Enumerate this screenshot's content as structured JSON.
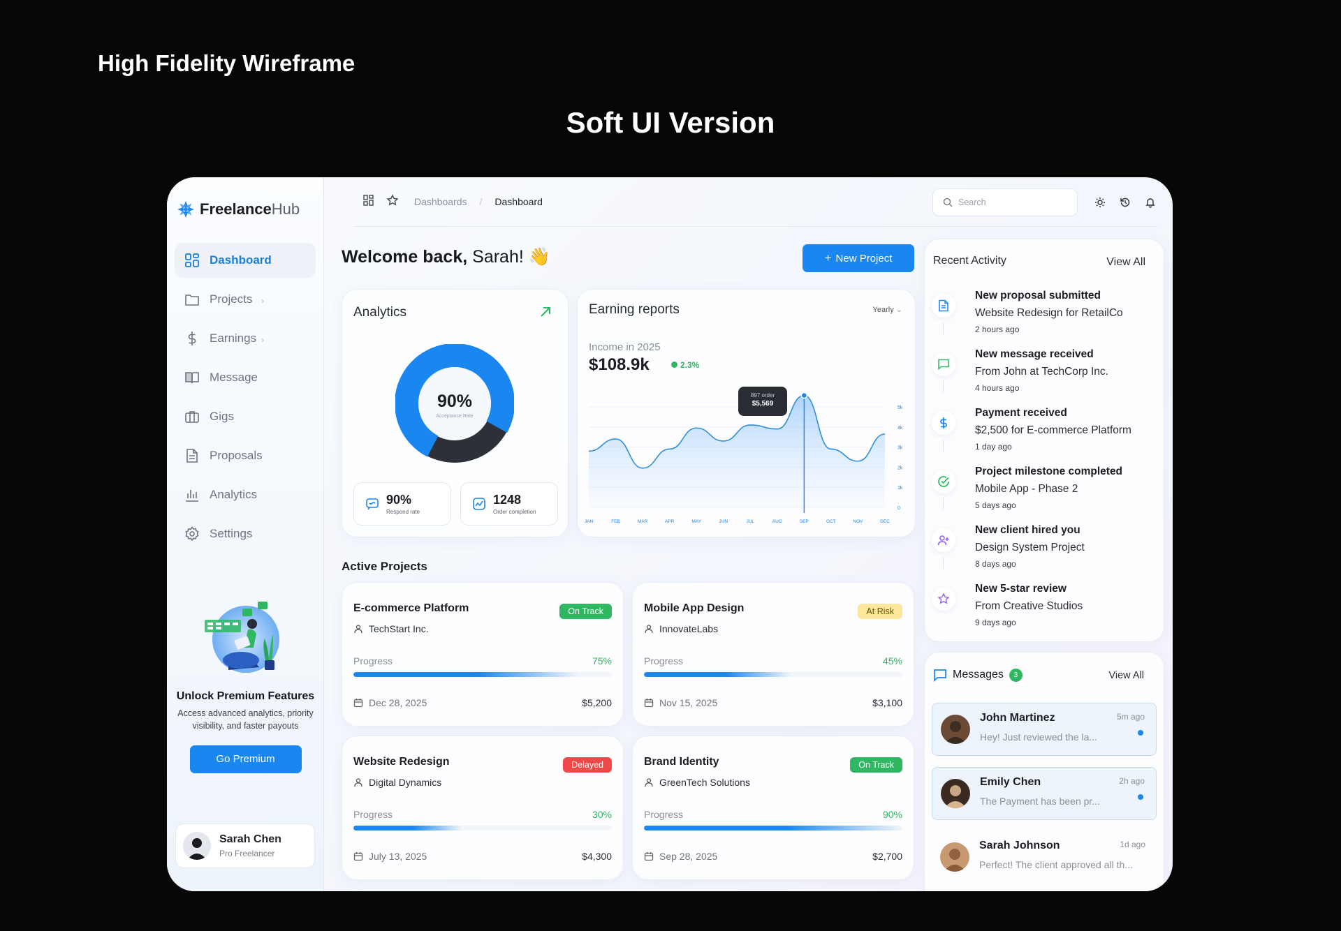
{
  "page": {
    "title": "High Fidelity Wireframe",
    "subtitle": "Soft UI Version"
  },
  "colors": {
    "accent": "#1a86f0",
    "success": "#2fb761",
    "warning": "#fde79a",
    "danger": "#f04848"
  },
  "brand": {
    "name_bold": "Freelance",
    "name_light": "Hub"
  },
  "nav": [
    {
      "label": "Dashboard",
      "icon": "grid-icon",
      "active": true
    },
    {
      "label": "Projects",
      "icon": "folder-icon"
    },
    {
      "label": "Earnings",
      "icon": "dollar-icon"
    },
    {
      "label": "Message",
      "icon": "book-icon"
    },
    {
      "label": "Gigs",
      "icon": "briefcase-icon"
    },
    {
      "label": "Proposals",
      "icon": "document-icon"
    },
    {
      "label": "Analytics",
      "icon": "bar-chart-icon"
    },
    {
      "label": "Settings",
      "icon": "gear-icon"
    }
  ],
  "promo": {
    "title": "Unlock Premium Features",
    "desc": "Access advanced analytics, priority visibility, and faster payouts",
    "button": "Go Premium"
  },
  "user": {
    "name": "Sarah Chen",
    "role": "Pro Freelancer"
  },
  "topbar": {
    "crumb_parent": "Dashboards",
    "crumb_current": "Dashboard",
    "search_placeholder": "Search"
  },
  "welcome": {
    "bold": "Welcome back,",
    "name": "Sarah! 👋",
    "new_button": "New Project"
  },
  "analytics": {
    "title": "Analytics",
    "acceptance_value": "90%",
    "acceptance_label": "Acceptance Rate",
    "acceptance_fraction": 0.9,
    "respond_value": "90%",
    "respond_label": "Respond rate",
    "order_value": "1248",
    "order_label": "Order completion"
  },
  "earnings": {
    "title": "Earning reports",
    "period": "Yearly",
    "income_label": "Income in 2025",
    "income_value": "$108.9k",
    "change": "2.3%",
    "tooltip_orders": "897 order",
    "tooltip_value": "$5,569"
  },
  "chart_data": {
    "type": "area",
    "title": "Earning reports",
    "categories": [
      "JAN",
      "FEB",
      "MAR",
      "APR",
      "MAY",
      "JUN",
      "JUL",
      "AUG",
      "SEP",
      "OCT",
      "NOV",
      "DEC"
    ],
    "y_ticks": [
      "5k",
      "4k",
      "3k",
      "2k",
      "1k",
      "0"
    ],
    "ylim": [
      0,
      5000
    ],
    "series": [
      {
        "values": [
          2800,
          3400,
          1950,
          2900,
          3950,
          3300,
          4100,
          3900,
          5569,
          2900,
          2300,
          3650
        ]
      }
    ],
    "highlight_index": 8
  },
  "active_projects": {
    "title": "Active Projects",
    "progress_label": "Progress",
    "items": [
      {
        "name": "E-commerce Platform",
        "client": "TechStart Inc.",
        "status": "On Track",
        "status_color": "#2fb761",
        "progress": "75%",
        "fraction": 0.75,
        "date": "Dec 28, 2025",
        "amount": "$5,200"
      },
      {
        "name": "Mobile App Design",
        "client": "InnovateLabs",
        "status": "At Risk",
        "status_color": "#fde79a",
        "progress": "45%",
        "fraction": 0.45,
        "date": "Nov 15, 2025",
        "amount": "$3,100"
      },
      {
        "name": "Website Redesign",
        "client": "Digital Dynamics",
        "status": "Delayed",
        "status_color": "#f04848",
        "progress": "30%",
        "fraction": 0.3,
        "date": "July 13, 2025",
        "amount": "$4,300"
      },
      {
        "name": "Brand Identity",
        "client": "GreenTech Solutions",
        "status": "On Track",
        "status_color": "#2fb761",
        "progress": "90%",
        "fraction": 0.9,
        "date": "Sep 28, 2025",
        "amount": "$2,700"
      }
    ]
  },
  "activity": {
    "title": "Recent Activity",
    "view_all": "View All",
    "items": [
      {
        "title": "New proposal submitted",
        "desc": "Website Redesign for RetailCo",
        "time": "2 hours ago",
        "icon": "document-icon"
      },
      {
        "title": "New message received",
        "desc": "From John at TechCorp Inc.",
        "time": "4 hours ago",
        "icon": "chat-icon"
      },
      {
        "title": "Payment received",
        "desc": "$2,500 for E-commerce Platform",
        "time": "1 day ago",
        "icon": "dollar-icon"
      },
      {
        "title": "Project milestone completed",
        "desc": "Mobile App - Phase 2",
        "time": "5 days ago",
        "icon": "check-circle-icon"
      },
      {
        "title": "New client hired you",
        "desc": "Design System Project",
        "time": "8 days ago",
        "icon": "user-plus-icon"
      },
      {
        "title": "New 5-star review",
        "desc": "From Creative Studios",
        "time": "9 days ago",
        "icon": "star-icon"
      }
    ]
  },
  "messages": {
    "title": "Messages",
    "count": "3",
    "view_all": "View All",
    "items": [
      {
        "name": "John Martinez",
        "preview": "Hey! Just reviewed the la...",
        "time": "5m ago",
        "unread": true
      },
      {
        "name": "Emily Chen",
        "preview": "The Payment has been pr...",
        "time": "2h ago",
        "unread": true
      },
      {
        "name": "Sarah Johnson",
        "preview": "Perfect! The client approved all th...",
        "time": "1d ago",
        "unread": false
      }
    ]
  }
}
